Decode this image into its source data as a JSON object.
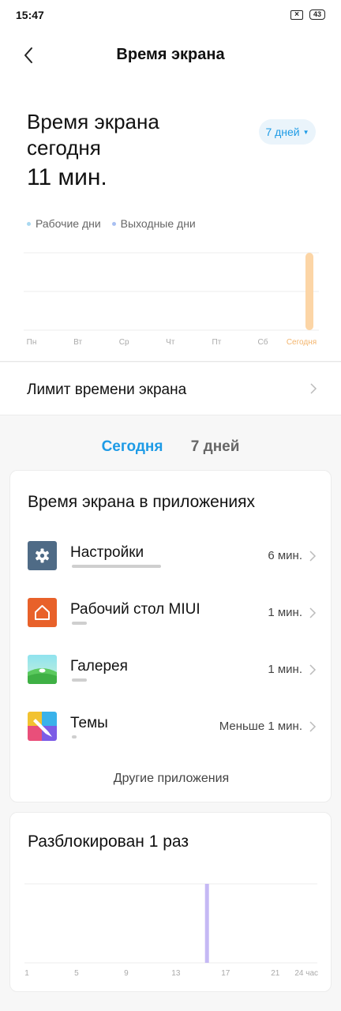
{
  "status_bar": {
    "time": "15:47",
    "sim_icon": "sim-disabled-icon",
    "battery": "43"
  },
  "header": {
    "title": "Время экрана",
    "back_icon": "chevron-left-icon"
  },
  "summary": {
    "title_line1": "Время экрана",
    "title_line2": "сегодня",
    "value": "11 мин.",
    "range_label": "7 дней"
  },
  "legend": {
    "workdays": {
      "label": "Рабочие дни",
      "color": "#a9d8f0"
    },
    "weekends": {
      "label": "Выходные дни",
      "color": "#a9c0f2"
    }
  },
  "week_chart": {
    "type": "bar",
    "categories": [
      "Пн",
      "Вт",
      "Ср",
      "Чт",
      "Пт",
      "Сб",
      "Сегодня"
    ],
    "values": [
      0,
      0,
      0,
      0,
      0,
      0,
      11
    ],
    "ylim": [
      0,
      11
    ],
    "today_color": "#fcd5a6",
    "today_label_color": "#f3b56d",
    "grid": true
  },
  "limit": {
    "label": "Лимит времени экрана"
  },
  "tabs": {
    "today": "Сегодня",
    "week": "7 дней",
    "active": "today"
  },
  "apps_card": {
    "title": "Время экрана в приложениях",
    "apps": [
      {
        "name": "Настройки",
        "time": "6 мин.",
        "usage": 0.55,
        "icon": "settings-gear-icon"
      },
      {
        "name": "Рабочий стол MIUI",
        "time": "1 мин.",
        "usage": 0.09,
        "icon": "home-launcher-icon"
      },
      {
        "name": "Галерея",
        "time": "1 мин.",
        "usage": 0.09,
        "icon": "gallery-icon"
      },
      {
        "name": "Темы",
        "time": "Меньше 1 мин.",
        "usage": 0.03,
        "icon": "themes-brush-icon"
      }
    ],
    "others_label": "Другие приложения"
  },
  "unlock_card": {
    "title": "Разблокирован 1 раз",
    "chart_data": {
      "type": "bar",
      "x_ticks": [
        "1",
        "5",
        "9",
        "13",
        "17",
        "21",
        "24 часа"
      ],
      "x_tick_values": [
        1,
        5,
        9,
        13,
        17,
        21,
        24
      ],
      "bars": [
        {
          "x": 15.5,
          "value": 1
        }
      ],
      "ylim": [
        0,
        1
      ],
      "bar_color": "#c5b8f4",
      "grid": true
    }
  }
}
